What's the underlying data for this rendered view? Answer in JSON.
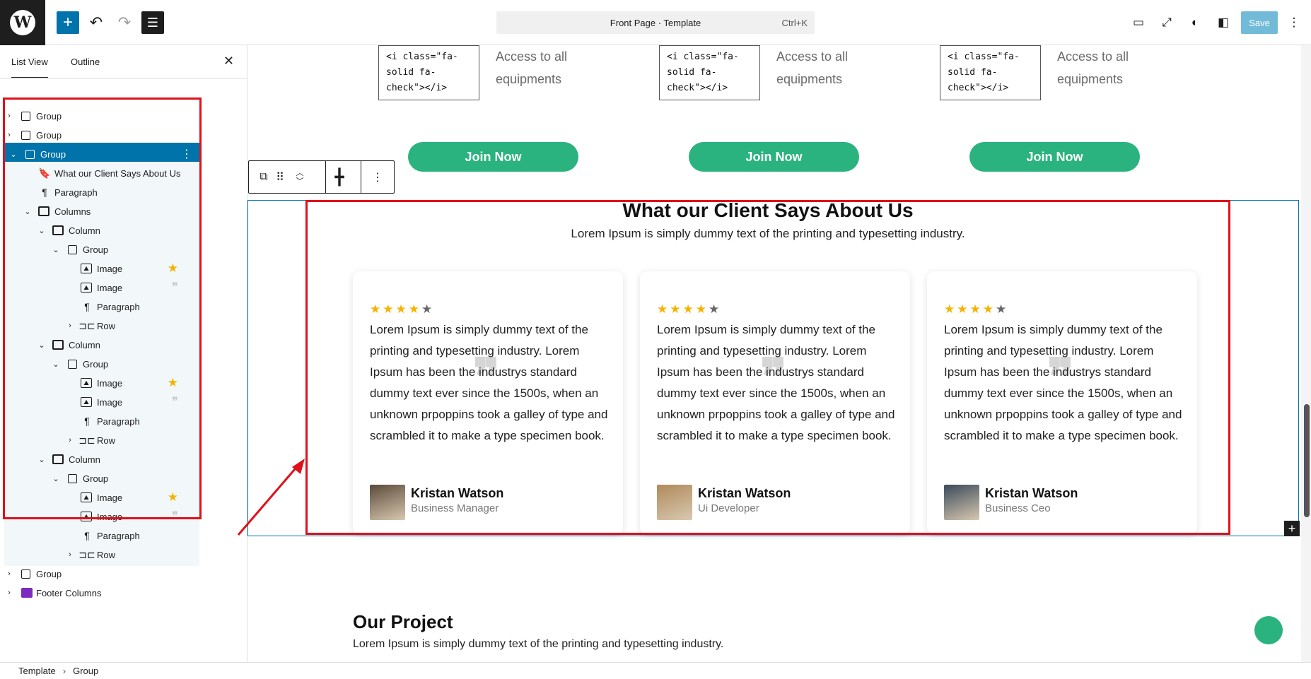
{
  "topbar": {
    "logo_letter": "W",
    "add_icon": "plus-icon",
    "undo_icon": "undo-icon",
    "redo_icon": "redo-icon",
    "document_overview_icon": "list-view-icon",
    "command_title": "Front Page · Template",
    "command_shortcut": "Ctrl+K",
    "save_label": "Save",
    "accent": "#0073aa"
  },
  "sidebar": {
    "tabs": [
      "List View",
      "Outline"
    ],
    "close_icon": "close-icon",
    "items": [
      {
        "label": "Group",
        "type": "group"
      },
      {
        "label": "Group",
        "type": "group"
      },
      {
        "label": "Group",
        "type": "group",
        "selected": true
      },
      {
        "label": "What our Client Says About Us",
        "type": "heading"
      },
      {
        "label": "Paragraph",
        "type": "paragraph"
      },
      {
        "label": "Columns",
        "type": "columns"
      },
      {
        "label": "Column",
        "type": "column"
      },
      {
        "label": "Group",
        "type": "group"
      },
      {
        "label": "Image",
        "type": "image",
        "badge": "star"
      },
      {
        "label": "Image",
        "type": "image",
        "badge": "quote"
      },
      {
        "label": "Paragraph",
        "type": "paragraph"
      },
      {
        "label": "Row",
        "type": "row"
      },
      {
        "label": "Column",
        "type": "column"
      },
      {
        "label": "Group",
        "type": "group"
      },
      {
        "label": "Image",
        "type": "image",
        "badge": "star"
      },
      {
        "label": "Image",
        "type": "image",
        "badge": "quote"
      },
      {
        "label": "Paragraph",
        "type": "paragraph"
      },
      {
        "label": "Row",
        "type": "row"
      },
      {
        "label": "Column",
        "type": "column"
      },
      {
        "label": "Group",
        "type": "group"
      },
      {
        "label": "Image",
        "type": "image",
        "badge": "star"
      },
      {
        "label": "Image",
        "type": "image",
        "badge": "quote"
      },
      {
        "label": "Paragraph",
        "type": "paragraph"
      },
      {
        "label": "Row",
        "type": "row"
      },
      {
        "label": "Group",
        "type": "group"
      },
      {
        "label": "Footer Columns",
        "type": "footer"
      }
    ]
  },
  "breadcrumb": [
    "Template",
    "Group"
  ],
  "pricing": {
    "icon_code": "<i class=\"fa-solid fa-check\"></i>",
    "feature_text": "Access to all equipments",
    "join_label": "Join Now"
  },
  "testimonials": {
    "title": "What our Client Says About Us",
    "subtitle": "Lorem Ipsum is simply dummy text of the printing and typesetting industry.",
    "rating": 4,
    "max_rating": 5,
    "quote_glyph": "❞",
    "cards": [
      {
        "text": "Lorem Ipsum is simply dummy text of the printing and typesetting industry. Lorem Ipsum has been the industrys standard dummy text ever since the 1500s, when an unknown prpoppins took a galley of type and scrambled it to make a type specimen book.",
        "name": "Kristan Watson",
        "role": "Business Manager"
      },
      {
        "text": "Lorem Ipsum is simply dummy text of the printing and typesetting industry. Lorem Ipsum has been the industrys standard dummy text ever since the 1500s, when an unknown prpoppins took a galley of type and scrambled it to make a type specimen book.",
        "name": "Kristan Watson",
        "role": "Ui Developer"
      },
      {
        "text": "Lorem Ipsum is simply dummy text of the printing and typesetting industry. Lorem Ipsum has been the industrys standard dummy text ever since the 1500s, when an unknown prpoppins took a galley of type and scrambled it to make a type specimen book.",
        "name": "Kristan Watson",
        "role": "Business Ceo"
      }
    ]
  },
  "project": {
    "title": "Our Project",
    "subtitle": "Lorem Ipsum is simply dummy text of the printing and typesetting industry."
  },
  "colors": {
    "brand_green": "#2bb37f",
    "star": "#f5b301",
    "highlight_red": "#e0101a",
    "footer_icon": "#7b2cbf"
  }
}
